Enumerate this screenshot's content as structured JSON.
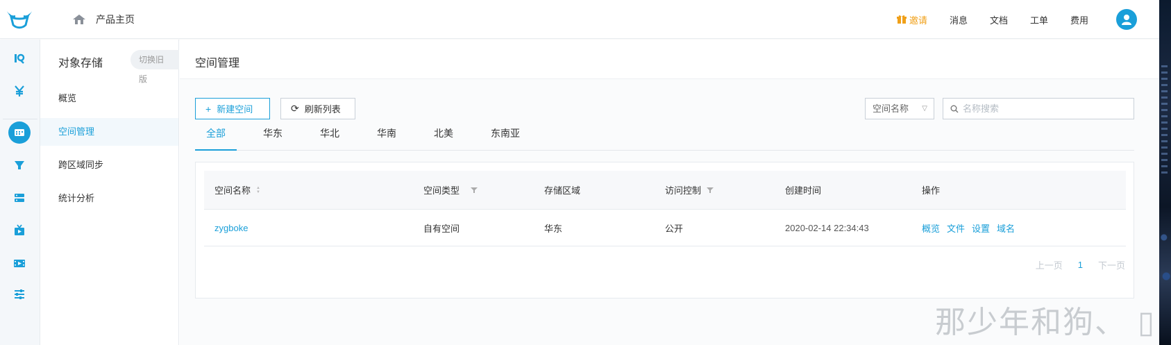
{
  "topbar": {
    "home_label": "产品主页",
    "nav": [
      "邀请",
      "消息",
      "文档",
      "工单",
      "费用"
    ]
  },
  "iconbar": {
    "icons": [
      "dashboard-icon",
      "billing-icon",
      "storage-icon",
      "cdn-icon",
      "compute-icon",
      "media-icon",
      "video-icon",
      "settings-sliders-icon"
    ]
  },
  "product_sidebar": {
    "title": "对象存储",
    "switch_old": "切换旧版",
    "menu": [
      "概览",
      "空间管理",
      "跨区域同步",
      "统计分析"
    ],
    "active_index": 1
  },
  "main": {
    "title": "空间管理",
    "new_bucket_label": "新建空间",
    "refresh_label": "刷新列表",
    "search_select_value": "空间名称",
    "search_placeholder": "名称搜索",
    "tabs": [
      "全部",
      "华东",
      "华北",
      "华南",
      "北美",
      "东南亚"
    ],
    "active_tab": 0,
    "table": {
      "columns": [
        "空间名称",
        "空间类型",
        "存储区域",
        "访问控制",
        "创建时间",
        "操作"
      ],
      "rows": [
        {
          "name": "zygboke",
          "type": "自有空间",
          "region": "华东",
          "access": "公开",
          "created": "2020-02-14 22:34:43",
          "ops": [
            "概览",
            "文件",
            "设置",
            "域名"
          ]
        }
      ]
    },
    "pager": {
      "prev": "上一页",
      "current": "1",
      "next": "下一页"
    }
  },
  "watermark": "那少年和狗、",
  "watermark_tail": "▯",
  "colors": {
    "accent": "#1a9fd9",
    "invite": "#f0a019"
  }
}
